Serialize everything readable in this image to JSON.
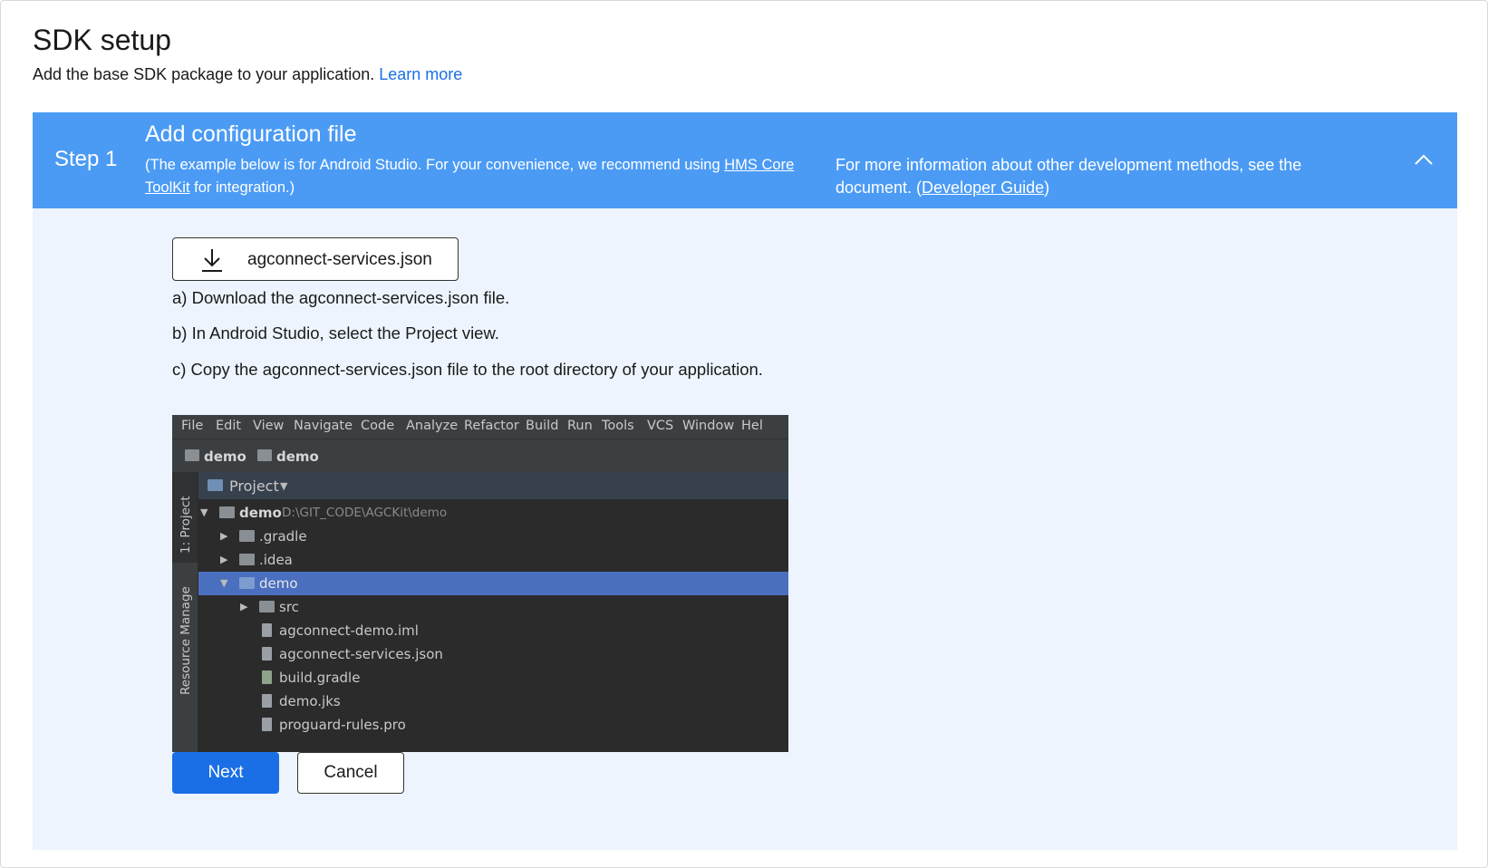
{
  "page": {
    "title": "SDK setup",
    "subtitle": "Add the base SDK package to your application.",
    "learn_more": "Learn more"
  },
  "step": {
    "label": "Step 1",
    "title": "Add configuration file",
    "note_prefix": "(The example below is for Android Studio. For your convenience, we recommend using ",
    "note_link": "HMS Core ToolKit",
    "note_suffix": " for integration.)",
    "more_prefix": "For more information about other development methods, see the document. (",
    "more_link": "Developer Guide",
    "more_suffix": ")",
    "collapse_icon": "chevron-up-icon"
  },
  "download": {
    "label": "agconnect-services.json",
    "icon": "download-icon"
  },
  "instructions": [
    "a) Download the agconnect-services.json file.",
    "b) In Android Studio, select the Project view.",
    "c) Copy the agconnect-services.json file to the root directory of your application."
  ],
  "ide": {
    "menu": [
      "File",
      "Edit",
      "View",
      "Navigate",
      "Code",
      "Analyze",
      "Refactor",
      "Build",
      "Run",
      "Tools",
      "VCS",
      "Window",
      "Hel"
    ],
    "breadcrumb": [
      "demo",
      "demo"
    ],
    "side_tabs": [
      "1: Project",
      "Resource Manage"
    ],
    "view_label": "Project",
    "tree": [
      {
        "label": "demo",
        "path": "D:\\GIT_CODE\\AGCKit\\demo"
      },
      {
        "label": ".gradle"
      },
      {
        "label": ".idea"
      },
      {
        "label": "demo"
      },
      {
        "label": "src"
      },
      {
        "label": "agconnect-demo.iml"
      },
      {
        "label": "agconnect-services.json"
      },
      {
        "label": "build.gradle"
      },
      {
        "label": "demo.jks"
      },
      {
        "label": "proguard-rules.pro"
      }
    ]
  },
  "actions": {
    "next": "Next",
    "cancel": "Cancel"
  },
  "colors": {
    "accent": "#1a6fe6",
    "header": "#4b9bf5",
    "panel": "#edf4fd"
  }
}
